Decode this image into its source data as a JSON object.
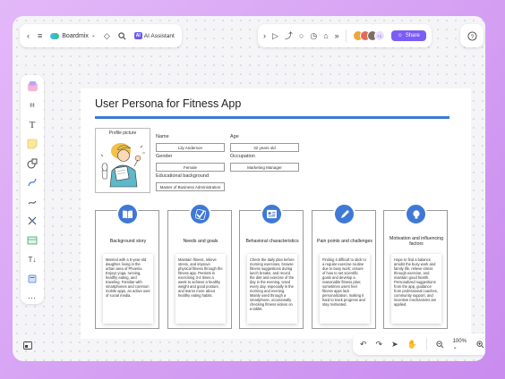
{
  "toolbar": {
    "brand": "Boardmix",
    "ai_label": "AI Assistant",
    "ai_badge": "AI",
    "share_label": "Share",
    "avatars": [
      "#f2a23a",
      "#e06b5a",
      "#7f6e66",
      "#b9a0e8"
    ],
    "avatar_more": "+1"
  },
  "page": {
    "title": "User Persona for Fitness App",
    "accent_color": "#3f78d6"
  },
  "profile": {
    "picture_label": "Profile picture",
    "fields": {
      "name_label": "Name",
      "name_value": "Lily Anderson",
      "age_label": "Age",
      "age_value": "32 years old",
      "gender_label": "Gender",
      "gender_value": "Female",
      "occupation_label": "Occupation",
      "occupation_value": "Marketing Manager",
      "education_label": "Educational background",
      "education_value": "Master of Business Administration"
    }
  },
  "cards": [
    {
      "title": "Background story",
      "icon": "book-icon",
      "body": "Married with a 5-year-old daughter, living in the urban area of Phoenix. Enjoys yoga, running, healthy eating, and traveling. Familiar with smartphones and common mobile apps, an active user of social media."
    },
    {
      "title": "Needs and goals",
      "icon": "checklist-icon",
      "body": "Maintain fitness, relieve stress, and improve physical fitness through the fitness app. Persists in exercising 3-4 times a week to achieve a healthy weight and good posture, and learns more about healthy eating habits."
    },
    {
      "title": "Behavioral characteristics",
      "icon": "id-card-icon",
      "body": "Check the daily plan before morning exercises, browse fitness suggestions during lunch breaks, and record the diet and exercise of the day in the evening. Used every day, especially in the morning and evening. Mainly used through a smartphone, occasionally checking fitness videos on a tablet."
    },
    {
      "title": "Pain points and challenges",
      "icon": "pen-icon",
      "body": "Finding it difficult to stick to a regular exercise routine due to busy work; unsure of how to set scientific goals and develop a reasonable fitness plan; sometimes users feel fitness apps lack personalization, making it hard to track progress and stay motivated."
    },
    {
      "title": "Motivation and influencing factors",
      "icon": "lightbulb-icon",
      "body": "Hope to find a balance amidst the busy work and family life, relieve stress through exercise, and maintain good health. Personalized suggestions from the app, guidance from professional coaches, community support, and incentive mechanisms are applied."
    }
  ],
  "bottom": {
    "zoom": "100%"
  }
}
